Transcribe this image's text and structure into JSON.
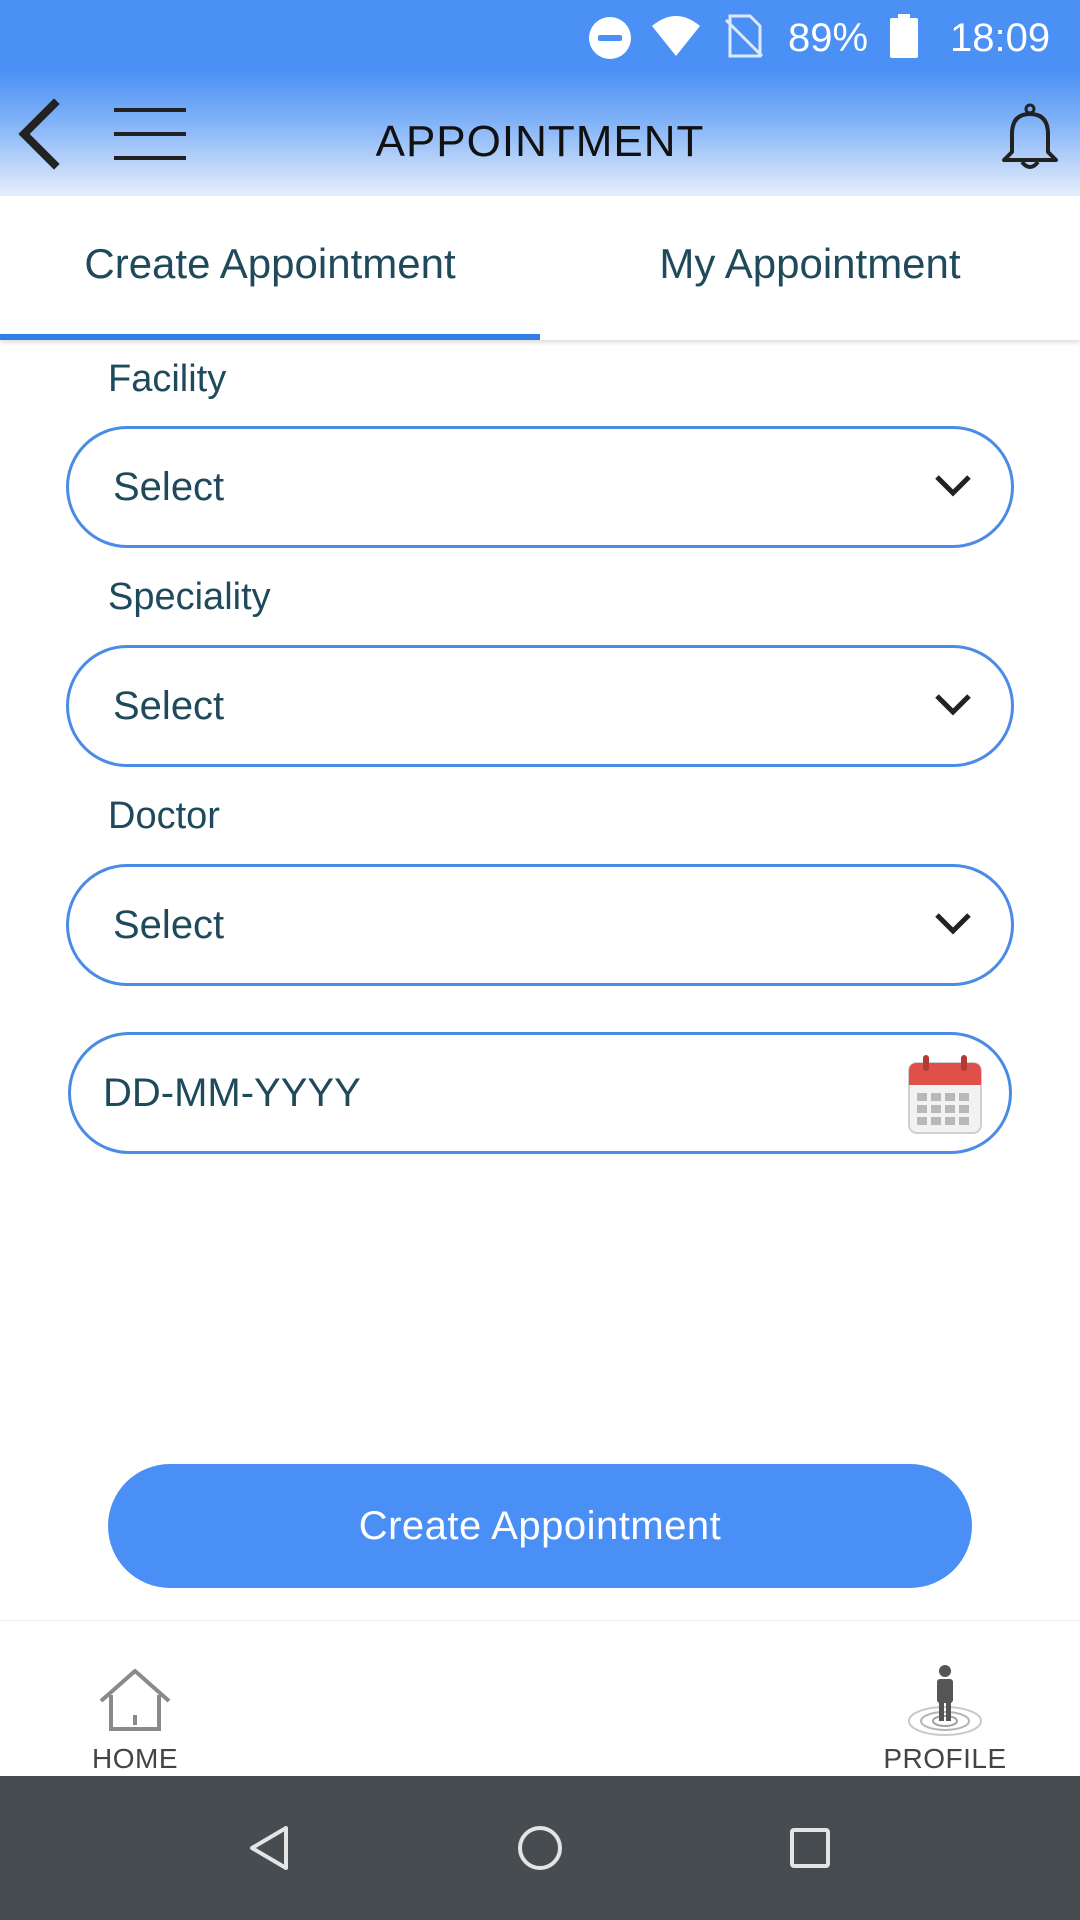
{
  "status_bar": {
    "battery_percent": "89%",
    "time": "18:09",
    "icons": [
      "do-not-disturb-icon",
      "wifi-icon",
      "no-sim-icon",
      "battery-icon"
    ]
  },
  "app_bar": {
    "title": "APPOINTMENT",
    "icons": [
      "back-arrow-icon",
      "hamburger-menu-icon",
      "bell-icon"
    ]
  },
  "tabs": [
    {
      "label": "Create Appointment",
      "active": true
    },
    {
      "label": "My Appointment",
      "active": false
    }
  ],
  "form": {
    "facility": {
      "label": "Facility",
      "value": "Select"
    },
    "speciality": {
      "label": "Speciality",
      "value": "Select"
    },
    "doctor": {
      "label": "Doctor",
      "value": "Select"
    },
    "date": {
      "placeholder": "DD-MM-YYYY"
    },
    "submit_label": "Create Appointment"
  },
  "bottom_nav": {
    "home": "HOME",
    "profile": "PROFILE"
  },
  "colors": {
    "primary": "#4a8ff5",
    "tab_indicator": "#2f7fe8",
    "text": "#1f4a5c",
    "calendar_red": "#e0504a",
    "system_nav": "#464c50"
  }
}
